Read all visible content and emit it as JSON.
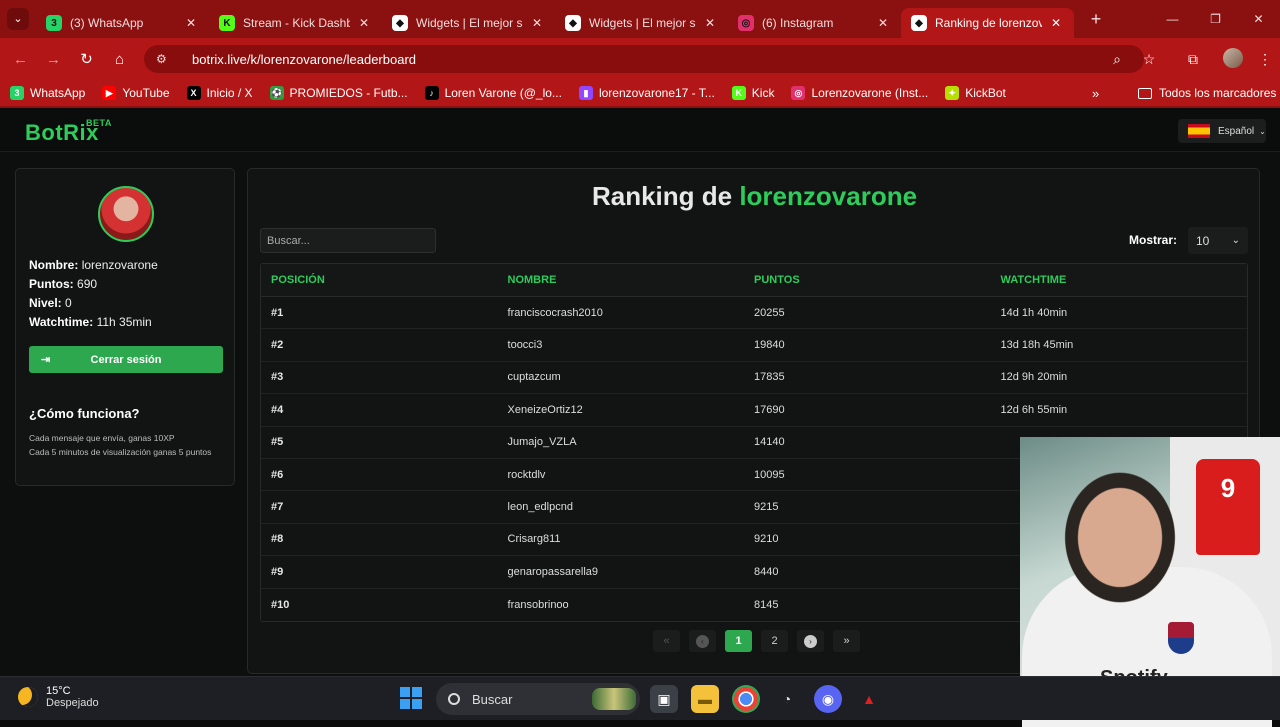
{
  "browser": {
    "tabs": [
      {
        "title": "(3) WhatsApp",
        "favicon": "whatsapp-icon",
        "badge": "3",
        "color": "#25d366"
      },
      {
        "title": "Stream - Kick Dashboard",
        "favicon": "kick-icon",
        "badge": "K",
        "color": "#53fc18"
      },
      {
        "title": "Widgets | El mejor software",
        "favicon": "botrix-icon",
        "badge": "◆",
        "color": "#ffffff"
      },
      {
        "title": "Widgets | El mejor software",
        "favicon": "botrix-icon",
        "badge": "◆",
        "color": "#ffffff"
      },
      {
        "title": "(6) Instagram",
        "favicon": "instagram-icon",
        "badge": "◎",
        "color": "#e1306c"
      },
      {
        "title": "Ranking de lorenzovarone",
        "favicon": "botrix-icon",
        "badge": "◆",
        "color": "#ffffff"
      }
    ],
    "url": "botrix.live/k/lorenzovarone/leaderboard",
    "bookmarks": [
      {
        "label": "WhatsApp",
        "icon": "whatsapp-icon",
        "color": "#25d366",
        "glyph": "3"
      },
      {
        "label": "YouTube",
        "icon": "youtube-icon",
        "color": "#ff0000",
        "glyph": "▶"
      },
      {
        "label": "Inicio / X",
        "icon": "x-icon",
        "color": "#000000",
        "glyph": "X"
      },
      {
        "label": "PROMIEDOS - Futb...",
        "icon": "promiedos-icon",
        "color": "#2e9e3e",
        "glyph": "⚽"
      },
      {
        "label": "Loren Varone (@_lo...",
        "icon": "tiktok-icon",
        "color": "#000000",
        "glyph": "♪"
      },
      {
        "label": "lorenzovarone17 - T...",
        "icon": "twitch-icon",
        "color": "#9146ff",
        "glyph": "▮"
      },
      {
        "label": "Kick",
        "icon": "kick-icon",
        "color": "#53fc18",
        "glyph": "K"
      },
      {
        "label": "Lorenzovarone (Inst...",
        "icon": "instagram-icon",
        "color": "#e1306c",
        "glyph": "◎"
      },
      {
        "label": "KickBot",
        "icon": "kickbot-icon",
        "color": "#b7e000",
        "glyph": "✦"
      }
    ],
    "all_bookmarks": "Todos los marcadores"
  },
  "site": {
    "logo": "BotRix",
    "logo_badge": "BETA",
    "language": "Español"
  },
  "profile": {
    "name_label": "Nombre:",
    "name": "lorenzovarone",
    "points_label": "Puntos:",
    "points": "690",
    "level_label": "Nivel:",
    "level": "0",
    "watchtime_label": "Watchtime:",
    "watchtime": "11h 35min",
    "logout": "Cerrar sesión",
    "how_title": "¿Cómo funciona?",
    "how_lines": [
      "Cada mensaje que envía, ganas 10XP",
      "Cada 5 minutos de visualización ganas 5 puntos"
    ]
  },
  "leaderboard": {
    "title_prefix": "Ranking de",
    "title_name": "lorenzovarone",
    "search_placeholder": "Buscar...",
    "show_label": "Mostrar:",
    "show_value": "10",
    "columns": [
      "POSICIÓN",
      "NOMBRE",
      "PUNTOS",
      "WATCHTIME"
    ],
    "rows": [
      [
        "#1",
        "franciscocrash2010",
        "20255",
        "14d 1h 40min"
      ],
      [
        "#2",
        "toocci3",
        "19840",
        "13d 18h 45min"
      ],
      [
        "#3",
        "cuptazcum",
        "17835",
        "12d 9h 20min"
      ],
      [
        "#4",
        "XeneizeOrtiz12",
        "17690",
        "12d 6h 55min"
      ],
      [
        "#5",
        "Jumajo_VZLA",
        "14140",
        ""
      ],
      [
        "#6",
        "rocktdlv",
        "10095",
        ""
      ],
      [
        "#7",
        "leon_edlpcnd",
        "9215",
        ""
      ],
      [
        "#8",
        "Crisarg811",
        "9210",
        ""
      ],
      [
        "#9",
        "genaropassarella9",
        "8440",
        ""
      ],
      [
        "#10",
        "fransobrinoo",
        "8145",
        ""
      ]
    ],
    "pagination": {
      "first": "«",
      "prev": "‹",
      "pages": [
        "1",
        "2"
      ],
      "current": "1",
      "next": "›",
      "last": "»"
    }
  },
  "webcam": {
    "brand": "Spotify",
    "jersey_number": "9"
  },
  "taskbar": {
    "temp": "15°C",
    "condition": "Despejado",
    "search": "Buscar"
  },
  "colors": {
    "accent": "#2ecc5a",
    "browser": "#b31616"
  }
}
